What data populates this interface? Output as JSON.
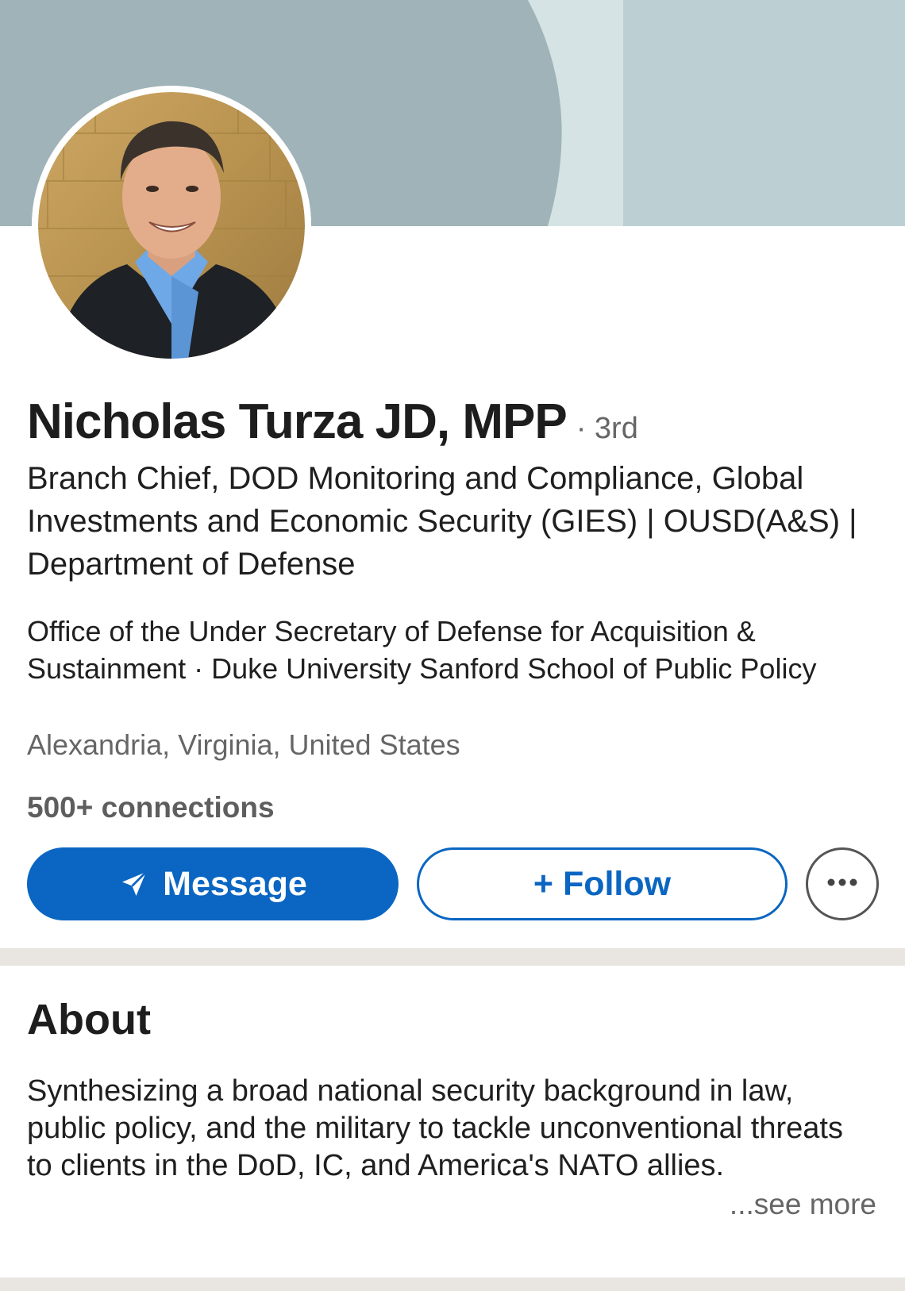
{
  "profile": {
    "name": "Nicholas Turza JD, MPP",
    "degree": "· 3rd",
    "headline": "Branch Chief, DOD Monitoring and Compliance, Global Investments and Economic Security (GIES) | OUSD(A&S) | Department of Defense",
    "affiliation": "Office of the Under Secretary of Defense for Acquisition & Sustainment · Duke University Sanford School of Public Policy",
    "location": "Alexandria, Virginia, United States",
    "connections": "500+ connections"
  },
  "actions": {
    "message_label": "Message",
    "follow_label": "+ Follow",
    "more_icon": "more-horizontal-icon"
  },
  "about": {
    "title": "About",
    "text": "Synthesizing a broad national security background in law, public policy, and the military to tackle unconventional threats to clients in the DoD, IC, and America's NATO allies.",
    "see_more": "...see more"
  },
  "colors": {
    "brand_blue": "#0a66c2",
    "banner_base": "#bcd0d4",
    "banner_shape": "#9fb3b8",
    "divider": "#e9e6e1"
  }
}
